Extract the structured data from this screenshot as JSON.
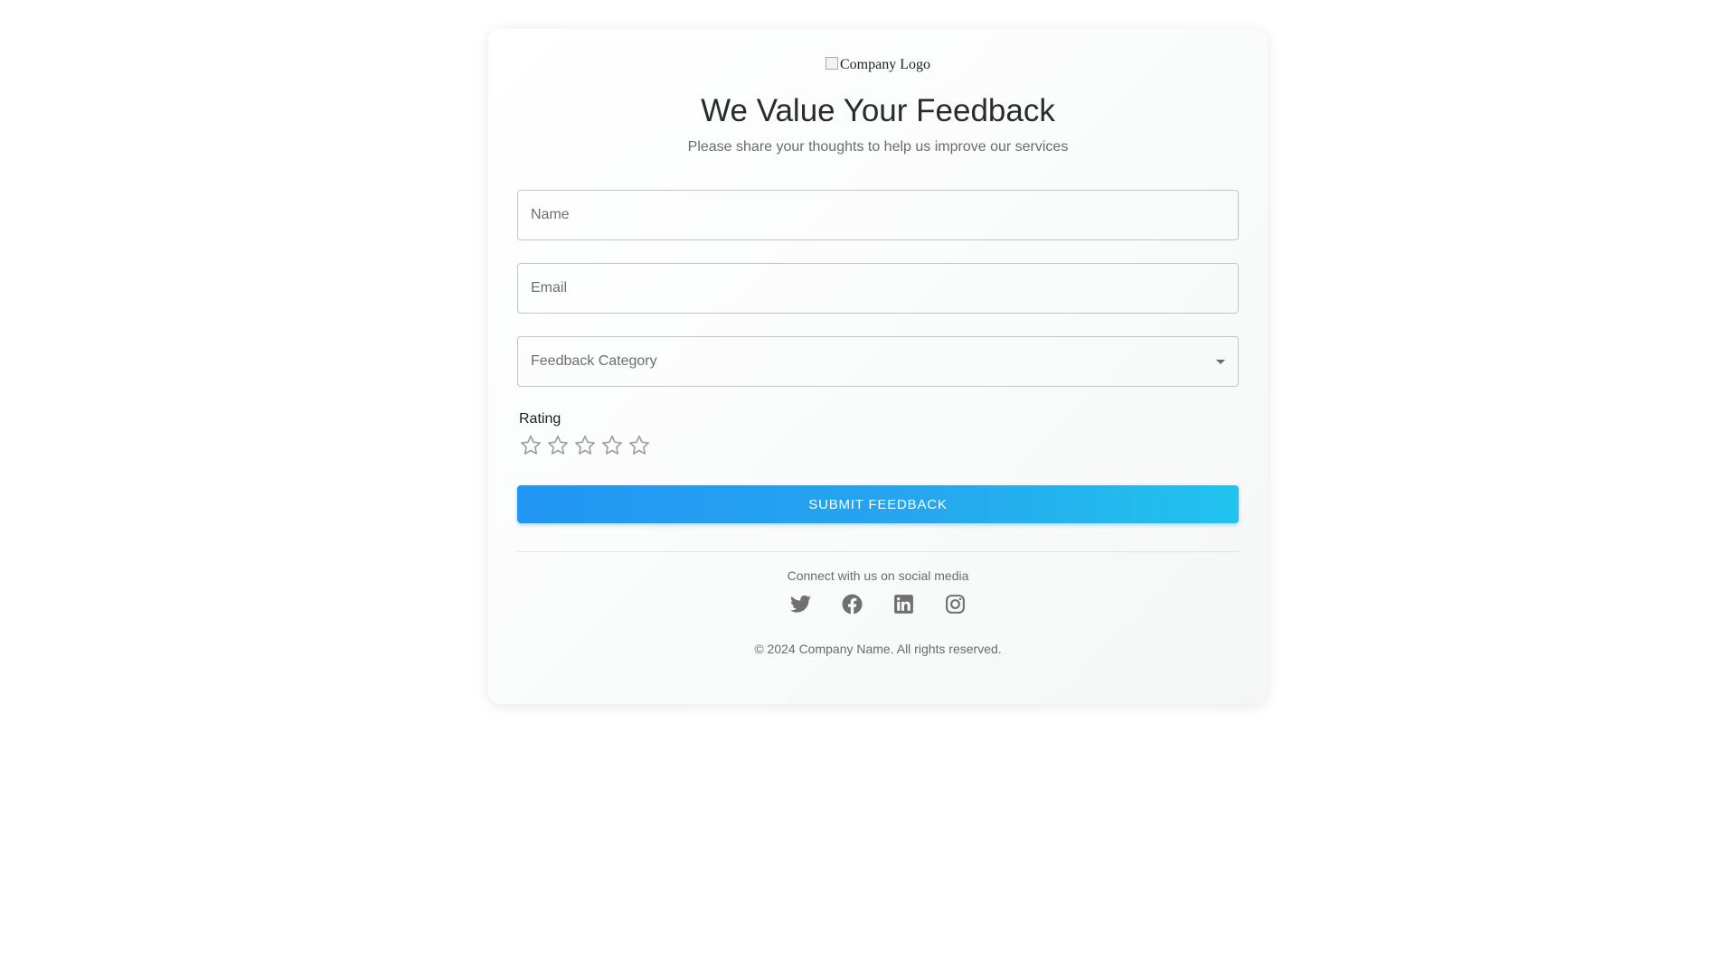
{
  "logo": {
    "alt_text": "Company Logo"
  },
  "header": {
    "title": "We Value Your Feedback",
    "subtitle": "Please share your thoughts to help us improve our services"
  },
  "form": {
    "name": {
      "placeholder": "Name",
      "value": ""
    },
    "email": {
      "placeholder": "Email",
      "value": ""
    },
    "category": {
      "label": "Feedback Category",
      "selected": ""
    },
    "rating": {
      "label": "Rating",
      "value": 0,
      "max": 5,
      "star_color": "#9e9e9e"
    },
    "submit_label": "SUBMIT FEEDBACK"
  },
  "footer": {
    "social_text": "Connect with us on social media",
    "social_icons": [
      "twitter-icon",
      "facebook-icon",
      "linkedin-icon",
      "instagram-icon"
    ],
    "copyright": "© 2024 Company Name. All rights reserved."
  },
  "colors": {
    "accent_start": "#2196f3",
    "accent_end": "#22c3ee",
    "icon_gray": "#707070"
  }
}
